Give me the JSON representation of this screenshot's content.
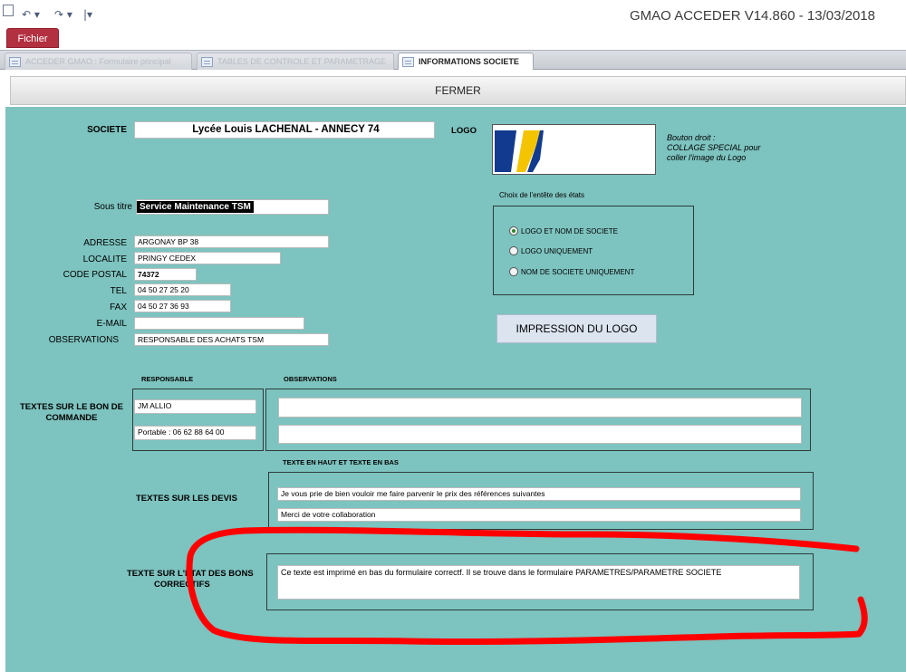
{
  "app": {
    "title": "GMAO ACCEDER V14.860 - 13/03/2018",
    "file_tab": "Fichier",
    "qat": {
      "undo": "↶ ▾",
      "redo": "↷ ▾",
      "customize": "|▾"
    }
  },
  "tabs": [
    {
      "label": "ACCEDER GMAO : Formulaire principal"
    },
    {
      "label": "TABLES DE CONTROLE ET PARAMETRAGE"
    },
    {
      "label": "INFORMATIONS SOCIETE"
    }
  ],
  "close_label": "FERMER",
  "company": {
    "label": "SOCIETE",
    "value": "Lycée Louis LACHENAL - ANNECY 74",
    "subtitle_label": "Sous titre",
    "subtitle_value": "Service Maintenance TSM",
    "address_label": "ADRESSE",
    "address_value": "ARGONAY BP 38",
    "city_label": "LOCALITE",
    "city_value": "PRINGY CEDEX",
    "postal_label": "CODE POSTAL",
    "postal_value": "74372",
    "tel_label": "TEL",
    "tel_value": "04 50 27 25 20",
    "fax_label": "FAX",
    "fax_value": "04 50 27 36 93",
    "email_label": "E-MAIL",
    "email_value": "",
    "obs_label": "OBSERVATIONS",
    "obs_value": "RESPONSABLE DES ACHATS TSM"
  },
  "logo": {
    "label": "LOGO",
    "hint_line1": "Bouton droit :",
    "hint_line2": "COLLAGE SPECIAL pour",
    "hint_line3": "coller  l'image du Logo",
    "colors": {
      "blue": "#123a8e",
      "yellow": "#f5c400"
    }
  },
  "header_choice": {
    "label": "Choix de l'entête des états",
    "options": [
      {
        "label": "LOGO ET NOM DE SOCIETE",
        "selected": true
      },
      {
        "label": "LOGO UNIQUEMENT",
        "selected": false
      },
      {
        "label": "NOM DE SOCIETE UNIQUEMENT",
        "selected": false
      }
    ]
  },
  "print_logo_label": "IMPRESSION DU LOGO",
  "order": {
    "label_line1": "TEXTES SUR LE BON DE",
    "label_line2": "COMMANDE",
    "responsible_header": "RESPONSABLE",
    "observations_header": "OBSERVATIONS",
    "responsible_1": "JM ALLIO",
    "responsible_2": "Portable : 06 62 88 64 00",
    "obs_1": "",
    "obs_2": ""
  },
  "quotes": {
    "header": "TEXTE EN HAUT ET TEXTE EN BAS",
    "label": "TEXTES SUR LES DEVIS",
    "top": "Je vous prie de bien vouloir me faire parvenir le prix des références suivantes",
    "bottom": "Merci de votre collaboration"
  },
  "corrective": {
    "label_line1": "TEXTE SUR L'ETAT DES BONS",
    "label_line2": "CORRECTIFS",
    "value": "Ce texte est imprimé en bas du formulaire correctf. Il se trouve dans le formulaire PARAMETRES/PARAMETRE SOCIETE"
  },
  "colors": {
    "form_bg": "#7dc3bf",
    "file_tab": "#b33041",
    "annotation": "#ff0000"
  }
}
